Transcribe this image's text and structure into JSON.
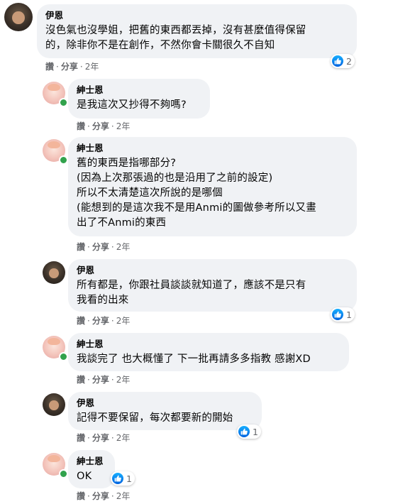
{
  "ui": {
    "like_label": "讚",
    "reply_label": "分享",
    "separator": "·",
    "time": "2年",
    "colors": {
      "like_blue": "#1877f2",
      "bubble": "#f0f2f5",
      "online": "#31a24c"
    },
    "icons": {
      "like": "thumbs-up-icon",
      "online": "online-status-dot"
    }
  },
  "comments": [
    {
      "author": "伊恩",
      "text": "沒色氣也沒學姐，把舊的東西都丟掉，沒有甚麼值得保留\n的，除非你不是在創作，不然你會卡關很久不自知",
      "reactions": "2",
      "avatar": "伊恩-avatar"
    },
    {
      "author": "紳士恩",
      "text": "是我這次又抄得不夠嗎?",
      "avatar": "紳士恩-avatar"
    },
    {
      "author": "紳士恩",
      "text": "舊的東西是指哪部分?\n(因為上次那張過的也是沿用了之前的設定)\n所以不太清楚這次所說的是哪個\n(能想到的是這次我不是用Anmi的圖做參考所以又畫\n出了不Anmi的東西",
      "avatar": "紳士恩-avatar"
    },
    {
      "author": "伊恩",
      "text": "所有都是，你跟社員談談就知道了，應該不是只有\n我看的出來",
      "reactions": "1",
      "avatar": "伊恩-avatar"
    },
    {
      "author": "紳士恩",
      "text": "我談完了 也大概懂了 下一批再請多多指教 感謝XD",
      "avatar": "紳士恩-avatar"
    },
    {
      "author": "伊恩",
      "text": "記得不要保留，每次都要新的開始",
      "reactions": "1",
      "avatar": "伊恩-avatar"
    },
    {
      "author": "紳士恩",
      "text": "OK",
      "reactions": "1",
      "avatar": "紳士恩-avatar"
    }
  ]
}
